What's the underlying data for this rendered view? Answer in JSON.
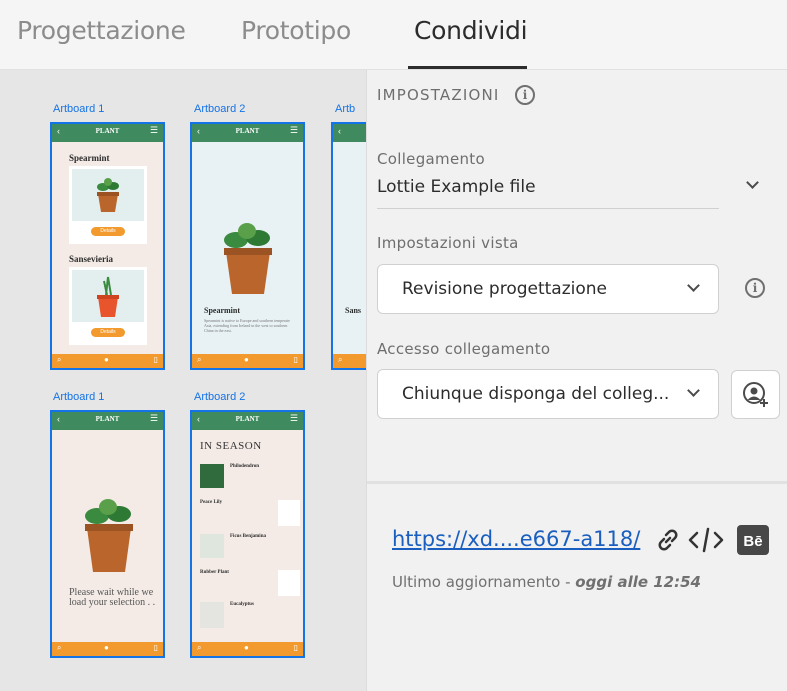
{
  "tabs": [
    {
      "label": "Progettazione"
    },
    {
      "label": "Prototipo"
    },
    {
      "label": "Condividi",
      "active": true
    }
  ],
  "artboards": [
    {
      "label": "Artboard 1",
      "title": "PLANT",
      "items": [
        "Spearmint",
        "Sansevieria"
      ],
      "button": "Details"
    },
    {
      "label": "Artboard 2",
      "title": "PLANT",
      "heading": "Spearmint",
      "text": "Spearmint is native to Europe and southern temperate Asia, extending from Ireland in the west to southern China in the east."
    },
    {
      "label": "Artb",
      "title": "PLANT",
      "heading": "Sans"
    },
    {
      "label": "Artboard 1",
      "title": "PLANT",
      "text": "Please wait while we load your selection . ."
    },
    {
      "label": "Artboard 2",
      "title": "PLANT",
      "heading": "IN SEASON",
      "list": [
        "Philodendron",
        "Peace Lily",
        "Ficus Benjamina",
        "Rubber Plant",
        "Eucalyptus"
      ]
    }
  ],
  "settings": {
    "heading": "IMPOSTAZIONI",
    "link_label": "Collegamento",
    "link_value": "Lottie Example file",
    "view_label": "Impostazioni vista",
    "view_value": "Revisione progettazione",
    "access_label": "Accesso collegamento",
    "access_value": "Chiunque disponga del colleg..."
  },
  "share": {
    "url": "https://xd....e667-a118/",
    "updated_prefix": "Ultimo aggiornamento - ",
    "updated_time": "oggi alle 12:54"
  },
  "colors": {
    "accent": "#1473e6",
    "plant_green": "#3f8a5f",
    "plant_orange": "#f29a2e"
  },
  "icons": [
    "info-icon",
    "chevron-down-icon",
    "add-user-icon",
    "link-icon",
    "embed-code-icon",
    "behance-icon"
  ]
}
